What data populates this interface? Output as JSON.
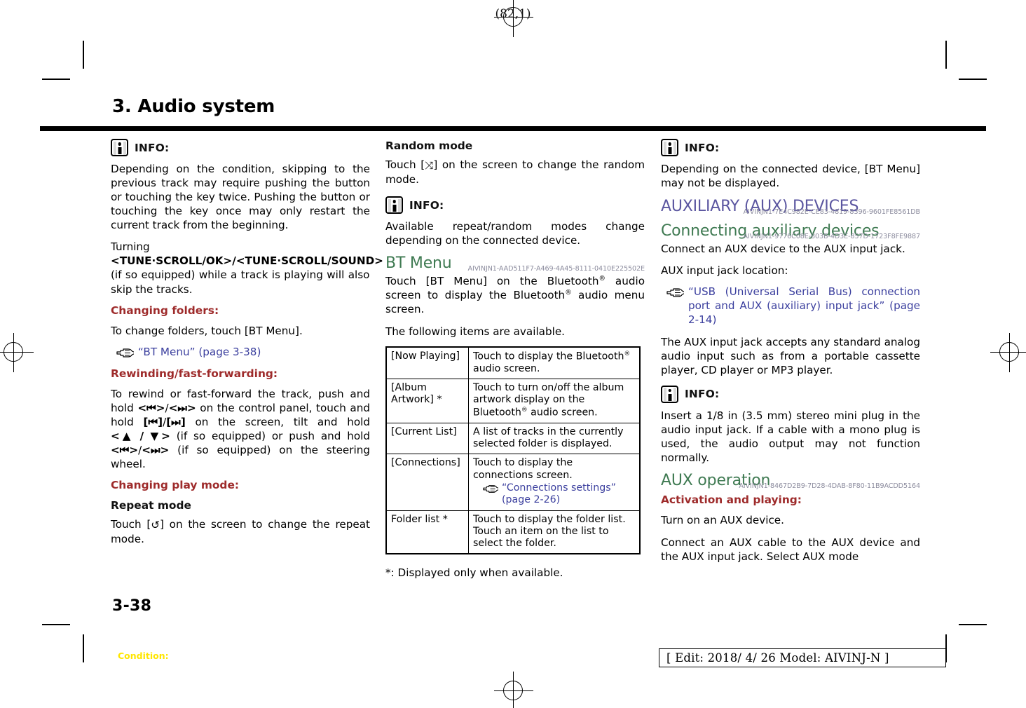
{
  "page": {
    "folio_mark": "(82,1)",
    "chapter_title": "3. Audio system",
    "page_number": "3-38",
    "condition_label": "Condition:",
    "edit_footer": "[ Edit: 2018/ 4/ 26   Model: AIVINJ-N ]"
  },
  "column1": {
    "info1": {
      "label": "INFO:",
      "paragraph1": "Depending on the condition, skipping to the previous track may require pushing the button or touching the key twice. Pushing the button or touching the key once may only restart the current track from the beginning.",
      "paragraph2_pre": "Turning ",
      "paragraph2_bold": "<TUNE·SCROLL/OK>/<TUNE·SCROLL/SOUND>",
      "paragraph2_post": " (if so equipped) while a track is playing will also skip the tracks."
    },
    "changing_folders": {
      "heading": "Changing folders:",
      "text": "To change folders, touch [BT Menu].",
      "link": "“BT Menu” (page 3-38)"
    },
    "rewinding": {
      "heading": "Rewinding/fast-forwarding:",
      "text_1": "To rewind or fast-forward the track, push and hold ",
      "ctl_prev_panel": "<⏮>",
      "text_2": "/",
      "ctl_next_panel": "<⏭>",
      "text_3": " on the control panel, touch and hold ",
      "ctl_prev_screen": "[⏮]",
      "text_4": "/",
      "ctl_next_screen": "[⏭]",
      "text_5": " on the screen, tilt and hold ",
      "ctl_tilt": "<▲ / ▼>",
      "text_6": " (if so equipped) or push and hold ",
      "ctl_prev_wheel": "<⏮>",
      "text_7": "/",
      "ctl_next_wheel": "<⏭>",
      "text_8": " (if so equipped) on the steering wheel."
    },
    "changing_play_mode": {
      "heading": "Changing play mode:",
      "repeat_heading": "Repeat mode",
      "repeat_text_pre": "Touch [",
      "repeat_icon": "↺",
      "repeat_text_post": "] on the screen to change the repeat mode."
    }
  },
  "column2": {
    "random_mode": {
      "heading": "Random mode",
      "text_pre": "Touch [",
      "icon": "⤨",
      "text_post": "] on the screen to change the random mode."
    },
    "info2": {
      "label": "INFO:",
      "paragraph": "Available repeat/random modes change depending on the connected device."
    },
    "bt_menu": {
      "heading": "BT Menu",
      "doc_id": "AIVINJN1-AAD511F7-A469-4A45-8111-0410E225502E",
      "paragraph1_a": "Touch [BT Menu] on the Bluetooth",
      "paragraph1_b": " audio screen to display the Bluetooth",
      "paragraph1_c": " audio menu screen.",
      "paragraph2": "The following items are available."
    },
    "table": {
      "rows": [
        {
          "key": "[Now Playing]",
          "value_a": "Touch to display the Bluetooth",
          "value_b": " audio screen."
        },
        {
          "key": "[Album Artwork] *",
          "value_a": "Touch to turn on/off the album artwork display on the Bluetooth",
          "value_b": " audio screen."
        },
        {
          "key": "[Current List]",
          "value_a": "A list of tracks in the currently selected folder is displayed.",
          "value_b": ""
        },
        {
          "key": "[Connections]",
          "value_a": "Touch to display the connections screen.",
          "value_b": "",
          "link": "“Connections settings” (page 2-26)"
        },
        {
          "key": "Folder list *",
          "value_a": "Touch to display the folder list. Touch an item on the list to select the folder.",
          "value_b": ""
        }
      ]
    },
    "footnote": "*: Displayed only when available."
  },
  "column3": {
    "info3": {
      "label": "INFO:",
      "paragraph": "Depending on the connected device, [BT Menu] may not be displayed."
    },
    "aux_devices": {
      "heading": "AUXILIARY (AUX) DEVICES",
      "doc_id": "AIVINJN1-7E4C982E-CE83-4819-8396-9601FE8561DB"
    },
    "connecting": {
      "heading": "Connecting auxiliary devices",
      "doc_id": "AIVINJN1-9776C08E-803B-4D3E-857D-1723F8FE9887",
      "paragraph1": "Connect an AUX device to the AUX input jack.",
      "paragraph2": "AUX input jack location:",
      "link": "“USB (Universal Serial Bus) connection port and AUX (auxiliary) input jack” (page 2-14)",
      "paragraph3": "The AUX input jack accepts any standard analog audio input such as from a portable cassette player, CD player or MP3 player."
    },
    "info4": {
      "label": "INFO:",
      "paragraph": "Insert a 1/8 in (3.5 mm) stereo mini plug in the audio input jack. If a cable with a mono plug is used, the audio output may not function normally."
    },
    "aux_operation": {
      "heading": "AUX operation",
      "doc_id": "AIVINJN1-8467D2B9-7D28-4DAB-8F80-11B9ACDD5164",
      "activation_heading": "Activation and playing:",
      "paragraph1": "Turn on an AUX device.",
      "paragraph2": "Connect an AUX cable to the AUX device and the AUX input jack. Select AUX mode"
    }
  },
  "colors": {
    "heading_red": "#9e2b2b",
    "heading_green": "#3f7a52",
    "heading_purple": "#5b56a0",
    "link_blue": "#3b3f9e",
    "doc_id_gray": "#8c8c9e",
    "condition_yellow": "#ffe600"
  }
}
